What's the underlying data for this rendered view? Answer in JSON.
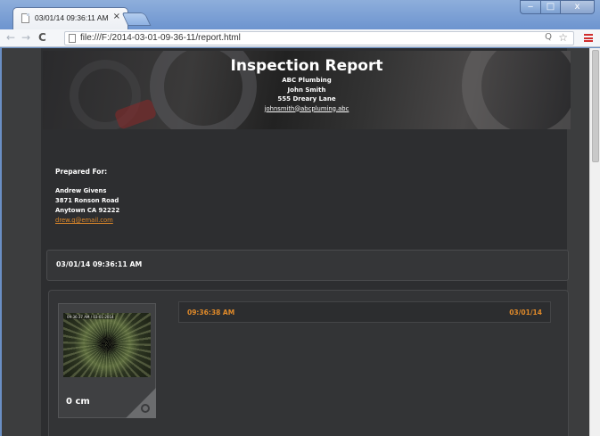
{
  "browser": {
    "tab_title": "03/01/14 09:36:11 AM",
    "tab_close": "×",
    "url": "file:///F:/2014-03-01-09-36-11/report.html",
    "back": "←",
    "forward": "→",
    "reload": "C",
    "zoom": "Q",
    "star": "☆",
    "minimize": "‒",
    "maximize": "□",
    "close": "x",
    "menu_color": "#d02d2d"
  },
  "report": {
    "title": "Inspection Report",
    "company": "ABC Plumbing",
    "inspector": "John Smith",
    "address": "555 Dreary Lane",
    "email": "johnsmith@abcpluming.abc"
  },
  "prepared_for": {
    "heading": "Prepared For:",
    "name": "Andrew Givens",
    "street": "3871 Ronson Road",
    "city": "Anytown CA 92222",
    "email": "drew.g@email.com"
  },
  "session": {
    "label": "03/01/14 09:36:11 AM"
  },
  "frame": {
    "thumb_stamp": "09:36:37 AM / 03-01-2014",
    "distance": "0 cm",
    "time": "09:36:38 AM",
    "date": "03/01/14",
    "accent_color": "#e08a2a"
  }
}
